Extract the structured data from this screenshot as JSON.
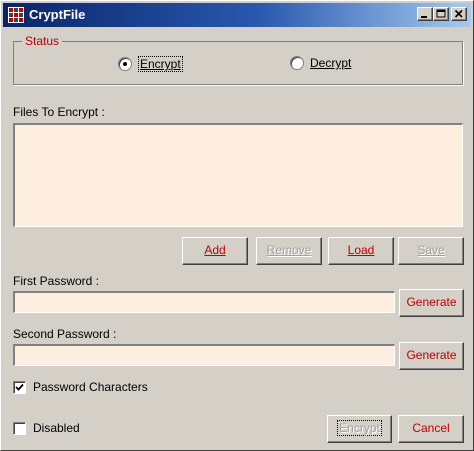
{
  "window": {
    "title": "CryptFile",
    "controls": [
      "minimize-icon",
      "maximize-icon",
      "close-icon"
    ]
  },
  "status": {
    "legend": "Status",
    "options": [
      {
        "label": "Encrypt",
        "checked": true
      },
      {
        "label": "Decrypt",
        "checked": false
      }
    ]
  },
  "files": {
    "label": "Files To Encrypt :",
    "items": []
  },
  "file_buttons": {
    "add": {
      "label": "Add",
      "enabled": true
    },
    "remove": {
      "label": "Remove",
      "enabled": false
    },
    "load": {
      "label": "Load",
      "enabled": true
    },
    "save": {
      "label": "Save",
      "enabled": false
    }
  },
  "first_password": {
    "label": "First Password :",
    "value": "",
    "generate_label": "Generate"
  },
  "second_password": {
    "label": "Second Password :",
    "value": "",
    "generate_label": "Generate"
  },
  "options": {
    "password_characters": {
      "label": "Password Characters",
      "checked": true
    },
    "disabled": {
      "label": "Disabled",
      "checked": false
    }
  },
  "footer": {
    "encrypt_label": "Encrypt",
    "cancel_label": "Cancel"
  },
  "colors": {
    "accent_text": "#c00000",
    "input_bg": "#fdeee0",
    "face": "#d4d0c8",
    "title_start": "#0a246a",
    "title_end": "#a6caf0"
  }
}
